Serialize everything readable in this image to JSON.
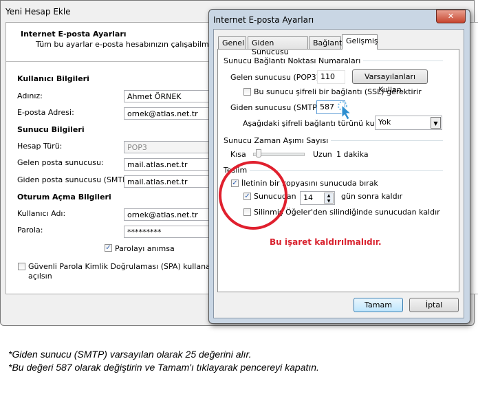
{
  "back_dialog": {
    "title": "Yeni Hesap Ekle",
    "header_title": "Internet E-posta Ayarları",
    "header_subtitle": "Tüm bu ayarlar e-posta hesabınızın çalışabilmesi için g",
    "user_section": "Kullanıcı Bilgileri",
    "name_label": "Adınız:",
    "name_value": "Ahmet ÖRNEK",
    "email_label": "E-posta Adresi:",
    "email_value": "ornek@atlas.net.tr",
    "server_section": "Sunucu Bilgileri",
    "account_type_label": "Hesap Türü:",
    "account_type_value": "POP3",
    "incoming_label": "Gelen posta sunucusu:",
    "incoming_value": "mail.atlas.net.tr",
    "outgoing_label": "Giden posta sunucusu (SMTP):",
    "outgoing_value": "mail.atlas.net.tr",
    "logon_section": "Oturum Açma Bilgileri",
    "username_label": "Kullanıcı Adı:",
    "username_value": "ornek@atlas.net.tr",
    "password_label": "Parola:",
    "password_value": "*********",
    "remember_password": "Parolayı anımsa",
    "spa_line1": "Güvenli Parola Kimlik Doğrulaması (SPA) kullanarak otur",
    "spa_line2": "açılsın"
  },
  "front_dialog": {
    "title": "Internet E-posta Ayarları",
    "tabs": [
      "Genel",
      "Giden Sunucusu",
      "Bağlantı",
      "Gelişmiş"
    ],
    "ports_group": "Sunucu Bağlantı Noktası Numaraları",
    "incoming_port_label": "Gelen sunucusu (POP3):",
    "incoming_port_value": "110",
    "defaults_button": "Varsayılanları Kullan",
    "ssl_label": "Bu sunucu şifreli bir bağlantı (SSL) gerektirir",
    "outgoing_port_label": "Giden sunucusu (SMTP):",
    "outgoing_port_value": "587",
    "encryption_label": "Aşağıdaki şifreli bağlantı türünü kullan:",
    "encryption_value": "Yok",
    "timeout_group": "Sunucu Zaman Aşımı Sayısı",
    "timeout_short": "Kısa",
    "timeout_long": "Uzun",
    "timeout_value": "1 dakika",
    "delivery_group": "Teslim",
    "leave_copy": "İletinin bir kopyasını sunucuda bırak",
    "remove_after": "Sunucudan",
    "remove_days": "14",
    "remove_after_suffix": "gün sonra kaldır",
    "remove_deleted": "Silinmiş Öğeler'den silindiğinde sunucudan kaldır",
    "annotation": "Bu işaret kaldırılmalıdır.",
    "ok_button": "Tamam",
    "cancel_button": "İptal"
  },
  "notes": [
    "*Giden sunucu (SMTP) varsayılan olarak 25 değerini alır.",
    "*Bu değeri 587 olarak değiştirin ve Tamam'ı tıklayarak pencereyi kapatın."
  ]
}
